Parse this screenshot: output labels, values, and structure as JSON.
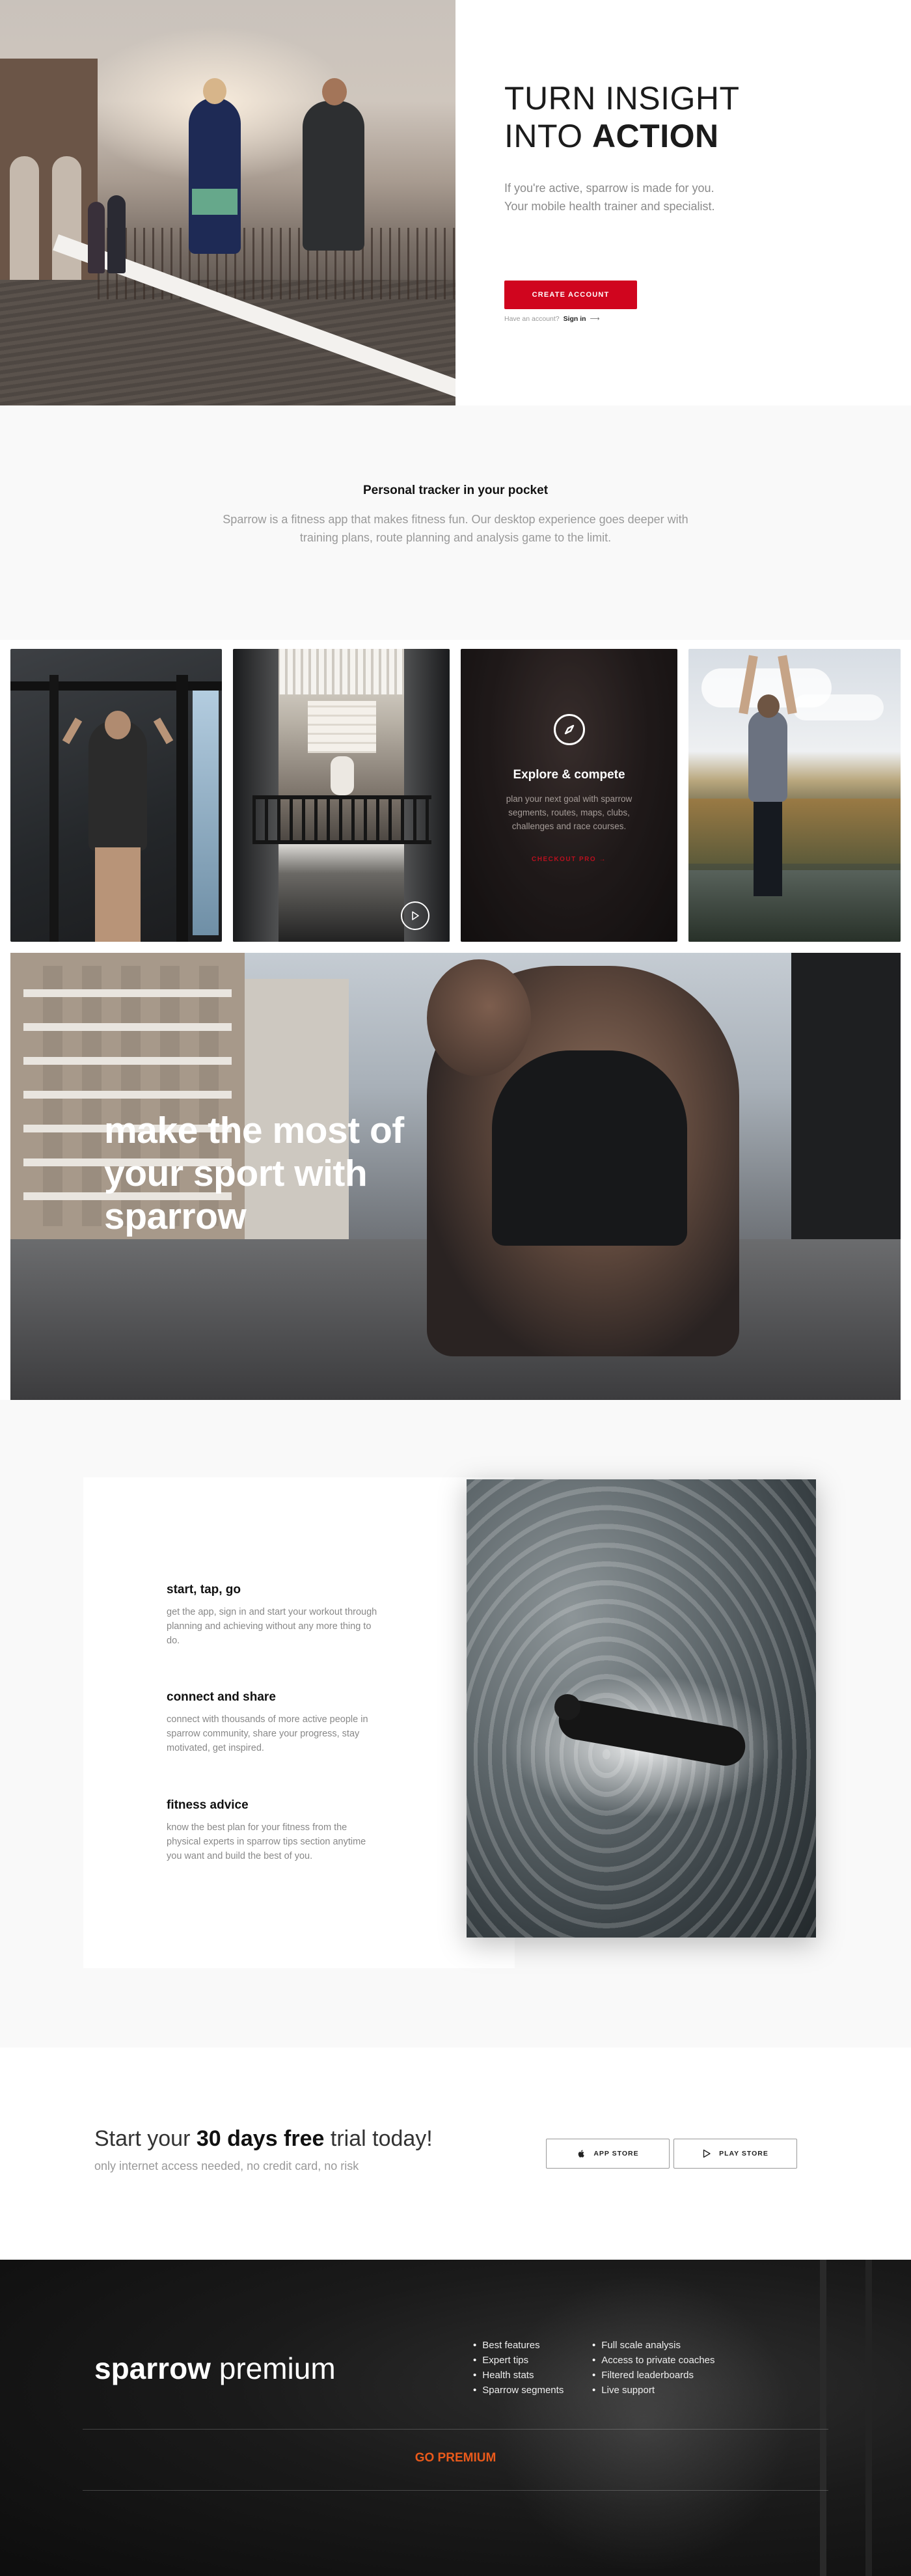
{
  "hero": {
    "title_line1": "TURN INSIGHT",
    "title_line2_light": "INTO",
    "title_line2_bold": "ACTION",
    "subtitle": "If you're active, sparrow is made for you. Your mobile health trainer and specialist.",
    "cta_label": "CREATE ACCOUNT",
    "signin_prompt": "Have an account?",
    "signin_link": "Sign in",
    "signin_arrow": "⟶"
  },
  "tracker": {
    "title": "Personal tracker in your pocket",
    "text": "Sparrow is a fitness app that makes fitness fun. Our desktop experience goes deeper with training plans, route planning and analysis game to the limit."
  },
  "gallery": {
    "explore_title": "Explore & compete",
    "explore_text": "plan your next goal with sparrow segments, routes, maps, clubs, challenges and race courses.",
    "explore_cta": "CHECKOUT PRO →"
  },
  "banner": {
    "title": "make the most of your sport with sparrow"
  },
  "features": [
    {
      "title": "start, tap, go",
      "text": "get the app, sign in and start your workout through planning and achieving without any more thing to do."
    },
    {
      "title": "connect and share",
      "text": "connect with thousands of more active people in sparrow community, share your progress, stay motivated, get inspired."
    },
    {
      "title": "fitness advice",
      "text": "know the best plan for your fitness from the physical experts in sparrow tips section anytime you want and build the best of you."
    }
  ],
  "trial": {
    "title_pre": "Start your",
    "title_bold": "30 days free",
    "title_post": "trial today!",
    "subtitle": "only internet access needed, no credit card, no risk",
    "app_store": "APP STORE",
    "play_store": "PLAY STORE"
  },
  "premium": {
    "brand_bold": "sparrow",
    "brand_light": "premium",
    "list_left": [
      "Best features",
      "Expert tips",
      "Health stats",
      "Sparrow segments"
    ],
    "list_right": [
      "Full scale analysis",
      "Access to private coaches",
      "Filtered leaderboards",
      "Live support"
    ],
    "cta": "GO PREMIUM"
  },
  "icons": {
    "compass": "compass-icon",
    "play": "play-icon",
    "apple": "apple-icon",
    "google_play": "play-store-icon"
  },
  "colors": {
    "accent_red": "#d0051e",
    "premium_orange": "#ea5a1b"
  }
}
